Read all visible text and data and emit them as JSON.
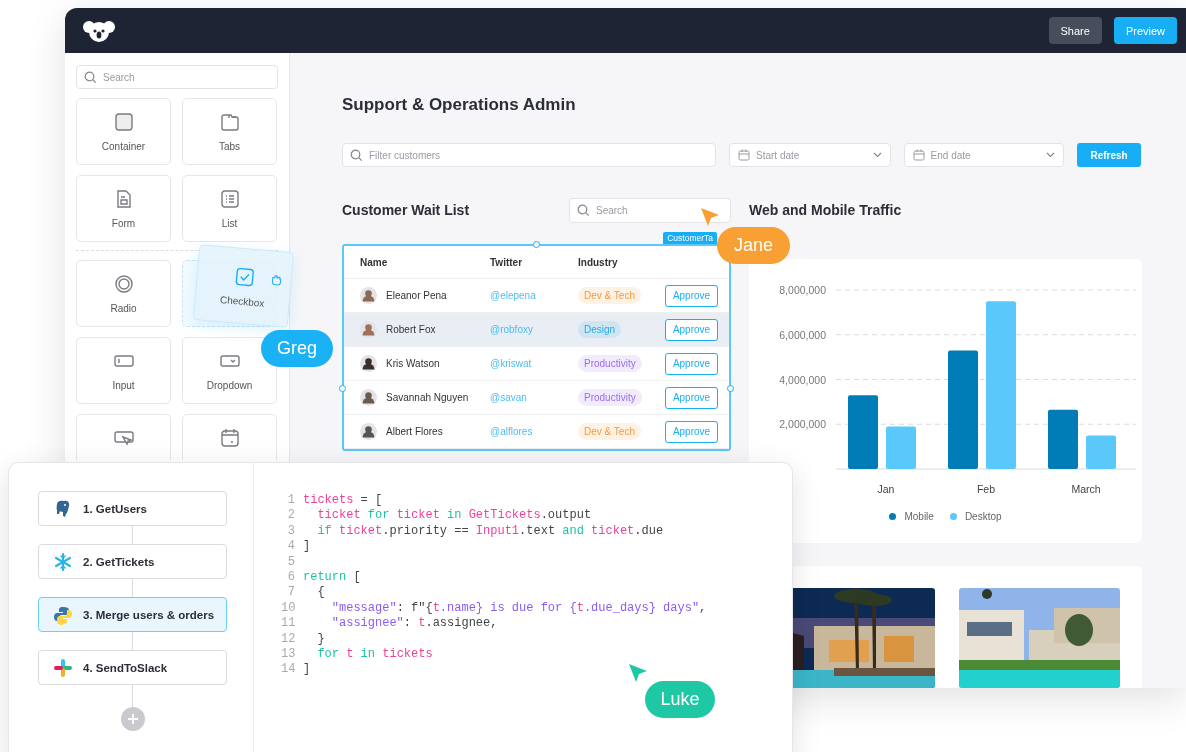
{
  "topbar": {
    "buttons": [
      {
        "label": "Share",
        "kind": "secondary"
      },
      {
        "label": "Preview",
        "kind": "primary"
      }
    ]
  },
  "sidebar": {
    "search": {
      "placeholder": "Search"
    },
    "groups": [
      {
        "tiles": [
          {
            "label": "Container",
            "dragging": false
          },
          {
            "label": "Tabs",
            "dragging": false
          },
          {
            "label": "Form",
            "dragging": false
          },
          {
            "label": "List",
            "dragging": false
          }
        ]
      },
      {
        "tiles": [
          {
            "label": "Radio",
            "dragging": false
          },
          {
            "label": "Checkbox",
            "dragging": true
          },
          {
            "label": "Input",
            "dragging": false
          },
          {
            "label": "Dropdown",
            "dragging": false
          },
          {
            "dragging": false
          },
          {
            "dragging": false
          }
        ]
      }
    ]
  },
  "main": {
    "title": "Support & Operations Admin",
    "filter": {
      "placeholder": "Filter customers"
    },
    "start_date": {
      "placeholder": "Start date"
    },
    "end_date": {
      "placeholder": "End date"
    },
    "refresh": "Refresh",
    "wait_list": {
      "title": "Customer Wait List",
      "search": {
        "placeholder": "Search"
      },
      "selection_label": "CustomerTa",
      "columns": [
        "Name",
        "Twitter",
        "Industry"
      ],
      "rows": [
        {
          "name": "Eleanor Pena",
          "twitter": "@elepena",
          "industry": {
            "label": "Dev & Tech",
            "color": "#f59a3c"
          },
          "action": "Approve",
          "selected": false
        },
        {
          "name": "Robert Fox",
          "twitter": "@robfoxy",
          "industry": {
            "label": "Design",
            "color": "#29a9e8"
          },
          "action": "Approve",
          "selected": true
        },
        {
          "name": "Kris Watson",
          "twitter": "@kriswat",
          "industry": {
            "label": "Productivity",
            "color": "#9a6cf0"
          },
          "action": "Approve",
          "selected": false
        },
        {
          "name": "Savannah Nguyen",
          "twitter": "@savan",
          "industry": {
            "label": "Productivity",
            "color": "#9a6cf0"
          },
          "action": "Approve",
          "selected": false
        },
        {
          "name": "Albert Flores",
          "twitter": "@alflores",
          "industry": {
            "label": "Dev & Tech",
            "color": "#f59a3c"
          },
          "action": "Approve",
          "selected": false
        }
      ]
    },
    "traffic": {
      "title": "Web and Mobile Traffic",
      "chart_data": {
        "type": "bar",
        "grid": true,
        "categories": [
          "Jan",
          "Feb",
          "March"
        ],
        "series": [
          {
            "name": "Mobile",
            "color": "#007cb7",
            "values": [
              3300000,
              5300000,
              2650000
            ]
          },
          {
            "name": "Desktop",
            "color": "#5ac8fa",
            "values": [
              1900000,
              7500000,
              1500000
            ]
          }
        ],
        "ylim": [
          0,
          8000000
        ],
        "yticks": [
          {
            "value": 2000000,
            "label": "2,000,000"
          },
          {
            "value": 4000000,
            "label": "4,000,000"
          },
          {
            "value": 6000000,
            "label": "6,000,000"
          },
          {
            "value": 8000000,
            "label": "8,000,000"
          }
        ]
      }
    }
  },
  "workflow": {
    "steps": [
      {
        "label": "1. GetUsers",
        "selected": false
      },
      {
        "label": "2. GetTickets",
        "selected": false
      },
      {
        "label": "3. Merge users & orders",
        "selected": true
      },
      {
        "label": "4. SendToSlack",
        "selected": false
      }
    ],
    "code": [
      {
        "number": "1",
        "tokens": [
          {
            "text": "tickets",
            "kind": "var"
          },
          {
            "text": " = [",
            "kind": "plain"
          }
        ]
      },
      {
        "number": "2",
        "tokens": [
          {
            "text": "  ticket",
            "kind": "var"
          },
          {
            "text": " for ",
            "kind": "kw"
          },
          {
            "text": "ticket",
            "kind": "var"
          },
          {
            "text": " in ",
            "kind": "kw"
          },
          {
            "text": "GetTickets",
            "kind": "var"
          },
          {
            "text": ".output",
            "kind": "plain"
          }
        ]
      },
      {
        "number": "3",
        "tokens": [
          {
            "text": "  if ",
            "kind": "kw"
          },
          {
            "text": "ticket",
            "kind": "var"
          },
          {
            "text": ".priority == ",
            "kind": "plain"
          },
          {
            "text": "Input1",
            "kind": "var"
          },
          {
            "text": ".text ",
            "kind": "plain"
          },
          {
            "text": "and ",
            "kind": "kw"
          },
          {
            "text": "ticket",
            "kind": "var"
          },
          {
            "text": ".due",
            "kind": "plain"
          }
        ]
      },
      {
        "number": "4",
        "tokens": [
          {
            "text": "]",
            "kind": "plain"
          }
        ]
      },
      {
        "number": "5"
      },
      {
        "number": "6",
        "tokens": [
          {
            "text": "return",
            "kind": "kw"
          },
          {
            "text": " [",
            "kind": "plain"
          }
        ]
      },
      {
        "number": "7",
        "tokens": [
          {
            "text": "  {",
            "kind": "plain"
          }
        ]
      },
      {
        "number": "10",
        "tokens": [
          {
            "text": "    \"message\"",
            "kind": "str"
          },
          {
            "text": ": f\"{",
            "kind": "plain"
          },
          {
            "text": "t",
            "kind": "var"
          },
          {
            "text": ".name} is due for {",
            "kind": "str"
          },
          {
            "text": "t",
            "kind": "var"
          },
          {
            "text": ".due_days} days\"",
            "kind": "str"
          },
          {
            "text": ",",
            "kind": "plain"
          }
        ]
      },
      {
        "number": "11",
        "tokens": [
          {
            "text": "    \"assignee\"",
            "kind": "str"
          },
          {
            "text": ": ",
            "kind": "plain"
          },
          {
            "text": "t",
            "kind": "var"
          },
          {
            "text": ".assignee,",
            "kind": "plain"
          }
        ]
      },
      {
        "number": "12",
        "tokens": [
          {
            "text": "  }",
            "kind": "plain"
          }
        ]
      },
      {
        "number": "13",
        "tokens": [
          {
            "text": "  for",
            "kind": "kw"
          },
          {
            "text": " t",
            "kind": "var"
          },
          {
            "text": " in",
            "kind": "kw"
          },
          {
            "text": " tickets",
            "kind": "var"
          }
        ]
      },
      {
        "number": "14",
        "tokens": [
          {
            "text": "]",
            "kind": "plain"
          }
        ]
      }
    ]
  },
  "cursors": [
    {
      "name": "Greg",
      "color": "#1ab2f5"
    },
    {
      "name": "Jane",
      "color": "#f8a033"
    },
    {
      "name": "Luke",
      "color": "#1ec8a5"
    }
  ]
}
